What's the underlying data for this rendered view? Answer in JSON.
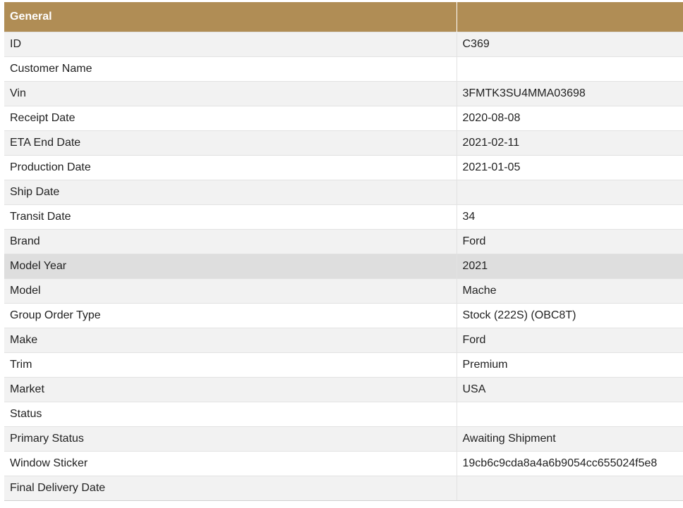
{
  "table": {
    "header": {
      "section_title": "General",
      "value_title": ""
    },
    "rows": [
      {
        "label": "ID",
        "value": "C369"
      },
      {
        "label": "Customer Name",
        "value": ""
      },
      {
        "label": "Vin",
        "value": "3FMTK3SU4MMA03698"
      },
      {
        "label": "Receipt Date",
        "value": "2020-08-08"
      },
      {
        "label": "ETA End Date",
        "value": "2021-02-11"
      },
      {
        "label": "Production Date",
        "value": "2021-01-05"
      },
      {
        "label": "Ship Date",
        "value": ""
      },
      {
        "label": "Transit Date",
        "value": "34"
      },
      {
        "label": "Brand",
        "value": "Ford"
      },
      {
        "label": "Model Year",
        "value": "2021"
      },
      {
        "label": "Model",
        "value": "Mache"
      },
      {
        "label": "Group Order Type",
        "value": "Stock (222S) (OBC8T)"
      },
      {
        "label": "Make",
        "value": "Ford"
      },
      {
        "label": "Trim",
        "value": "Premium"
      },
      {
        "label": "Market",
        "value": "USA"
      },
      {
        "label": "Status",
        "value": ""
      },
      {
        "label": "Primary Status",
        "value": "Awaiting Shipment"
      },
      {
        "label": "Window Sticker",
        "value": "19cb6c9cda8a4a6b9054cc655024f5e8"
      },
      {
        "label": "Final Delivery Date",
        "value": ""
      }
    ]
  },
  "colors": {
    "header_bg": "#b08d55",
    "header_text": "#ffffff",
    "row_odd": "#f2f2f2",
    "row_even": "#ffffff",
    "row_highlight": "#dedede"
  }
}
